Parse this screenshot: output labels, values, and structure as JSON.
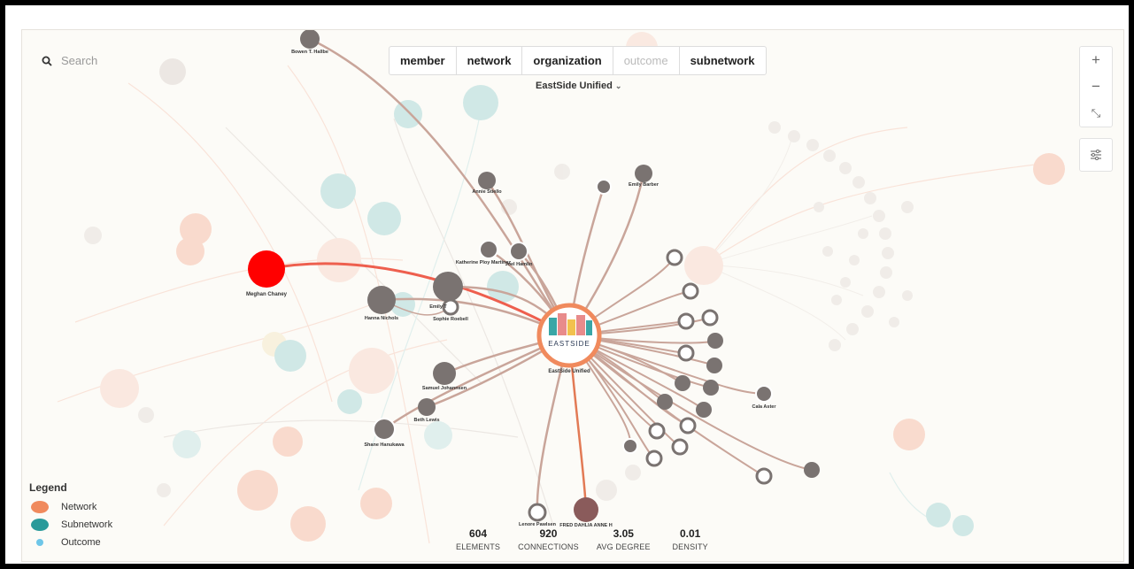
{
  "search": {
    "placeholder": "Search"
  },
  "tabs": [
    {
      "label": "member",
      "active": true
    },
    {
      "label": "network",
      "active": true
    },
    {
      "label": "organization",
      "active": true
    },
    {
      "label": "outcome",
      "active": false
    },
    {
      "label": "subnetwork",
      "active": true
    }
  ],
  "network_select": {
    "value": "EastSide Unified",
    "icon": "chevron-down-icon"
  },
  "center_node": {
    "label": "EastSide Unified",
    "logo_text": "EASTSIDE"
  },
  "nodes": [
    {
      "label": "Meghan Chaney"
    },
    {
      "label": "Hanna Nichols"
    },
    {
      "label": "Emily T"
    },
    {
      "label": "Sophie Roebell"
    },
    {
      "label": "Annie Stiello"
    },
    {
      "label": "Katherine Ploy Martinez"
    },
    {
      "label": "Joel Hamlin"
    },
    {
      "label": "Emily Barber"
    },
    {
      "label": "Samuel Johannsen"
    },
    {
      "label": "Beth Lewis"
    },
    {
      "label": "Shane Hanukawa"
    },
    {
      "label": "Cala Aster"
    },
    {
      "label": "Lenore Pawlsen"
    },
    {
      "label": "FRED DAHLIA ANNE H"
    },
    {
      "label": "Bowen T. Hallbe"
    }
  ],
  "zoom": {
    "zoom_in": "+",
    "zoom_out": "−",
    "fit": "⤡",
    "filter_icon": "sliders-icon"
  },
  "legend": {
    "title": "Legend",
    "items": [
      {
        "label": "Network",
        "color": "#f08a5d"
      },
      {
        "label": "Subnetwork",
        "color": "#2a9a9a"
      },
      {
        "label": "Outcome",
        "color": "#6ec6e8"
      }
    ]
  },
  "stats": [
    {
      "value": "604",
      "label": "ELEMENTS"
    },
    {
      "value": "920",
      "label": "CONNECTIONS"
    },
    {
      "value": "3.05",
      "label": "AVG DEGREE"
    },
    {
      "value": "0.01",
      "label": "DENSITY"
    }
  ],
  "colors": {
    "accent": "#f08a5d",
    "highlight": "#ff0000",
    "member": "#7a7371"
  }
}
